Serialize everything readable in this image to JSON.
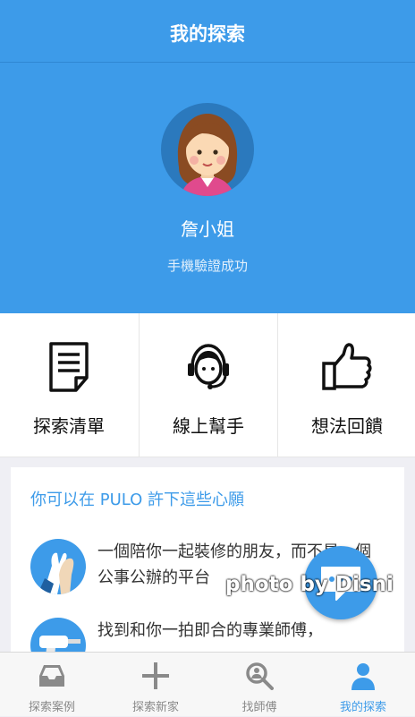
{
  "header": {
    "title": "我的探索"
  },
  "profile": {
    "name": "詹小姐",
    "verification": "手機驗證成功"
  },
  "quick_actions": [
    {
      "label": "探索清單",
      "icon": "document-icon"
    },
    {
      "label": "線上幫手",
      "icon": "headset-agent-icon"
    },
    {
      "label": "想法回饋",
      "icon": "thumbs-up-icon"
    }
  ],
  "wishes": {
    "title": "你可以在 PULO 許下這些心願",
    "items": [
      {
        "text": "一個陪你一起裝修的朋友，而不是一個公事公辦的平台",
        "icon": "high-five-icon"
      },
      {
        "text": "找到和你一拍即合的專業師傅，",
        "icon": "drill-icon"
      }
    ]
  },
  "fab": {
    "icon": "chat-bubble-icon"
  },
  "watermark": "photo by Disni",
  "tabs": [
    {
      "label": "探索案例",
      "icon": "inbox-tray-icon",
      "active": false
    },
    {
      "label": "探索新家",
      "icon": "plus-icon",
      "active": false
    },
    {
      "label": "找師傅",
      "icon": "search-person-icon",
      "active": false
    },
    {
      "label": "我的探索",
      "icon": "person-icon",
      "active": true
    }
  ],
  "colors": {
    "primary": "#3d9be9",
    "inactive": "#888888",
    "background": "#efeff4"
  }
}
